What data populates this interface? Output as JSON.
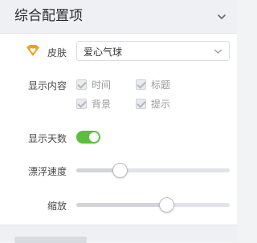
{
  "panel": {
    "title": "综合配置项",
    "collapse_icon": "chevron-down-icon"
  },
  "skin": {
    "label": "皮肤",
    "icon": "heart-badge-icon",
    "icon_color": "#f0a020",
    "selected": "爱心气球",
    "arrow_icon": "chevron-down-icon"
  },
  "display_content": {
    "label": "显示内容",
    "options": [
      {
        "label": "时间",
        "checked": true
      },
      {
        "label": "标题",
        "checked": true
      },
      {
        "label": "背景",
        "checked": true
      },
      {
        "label": "提示",
        "checked": true
      }
    ]
  },
  "show_days": {
    "label": "显示天数",
    "enabled": true,
    "color": "#5bbf3c"
  },
  "float_speed": {
    "label": "漂浮速度",
    "value": 0.29
  },
  "scale": {
    "label": "缩放",
    "value": 0.59
  }
}
